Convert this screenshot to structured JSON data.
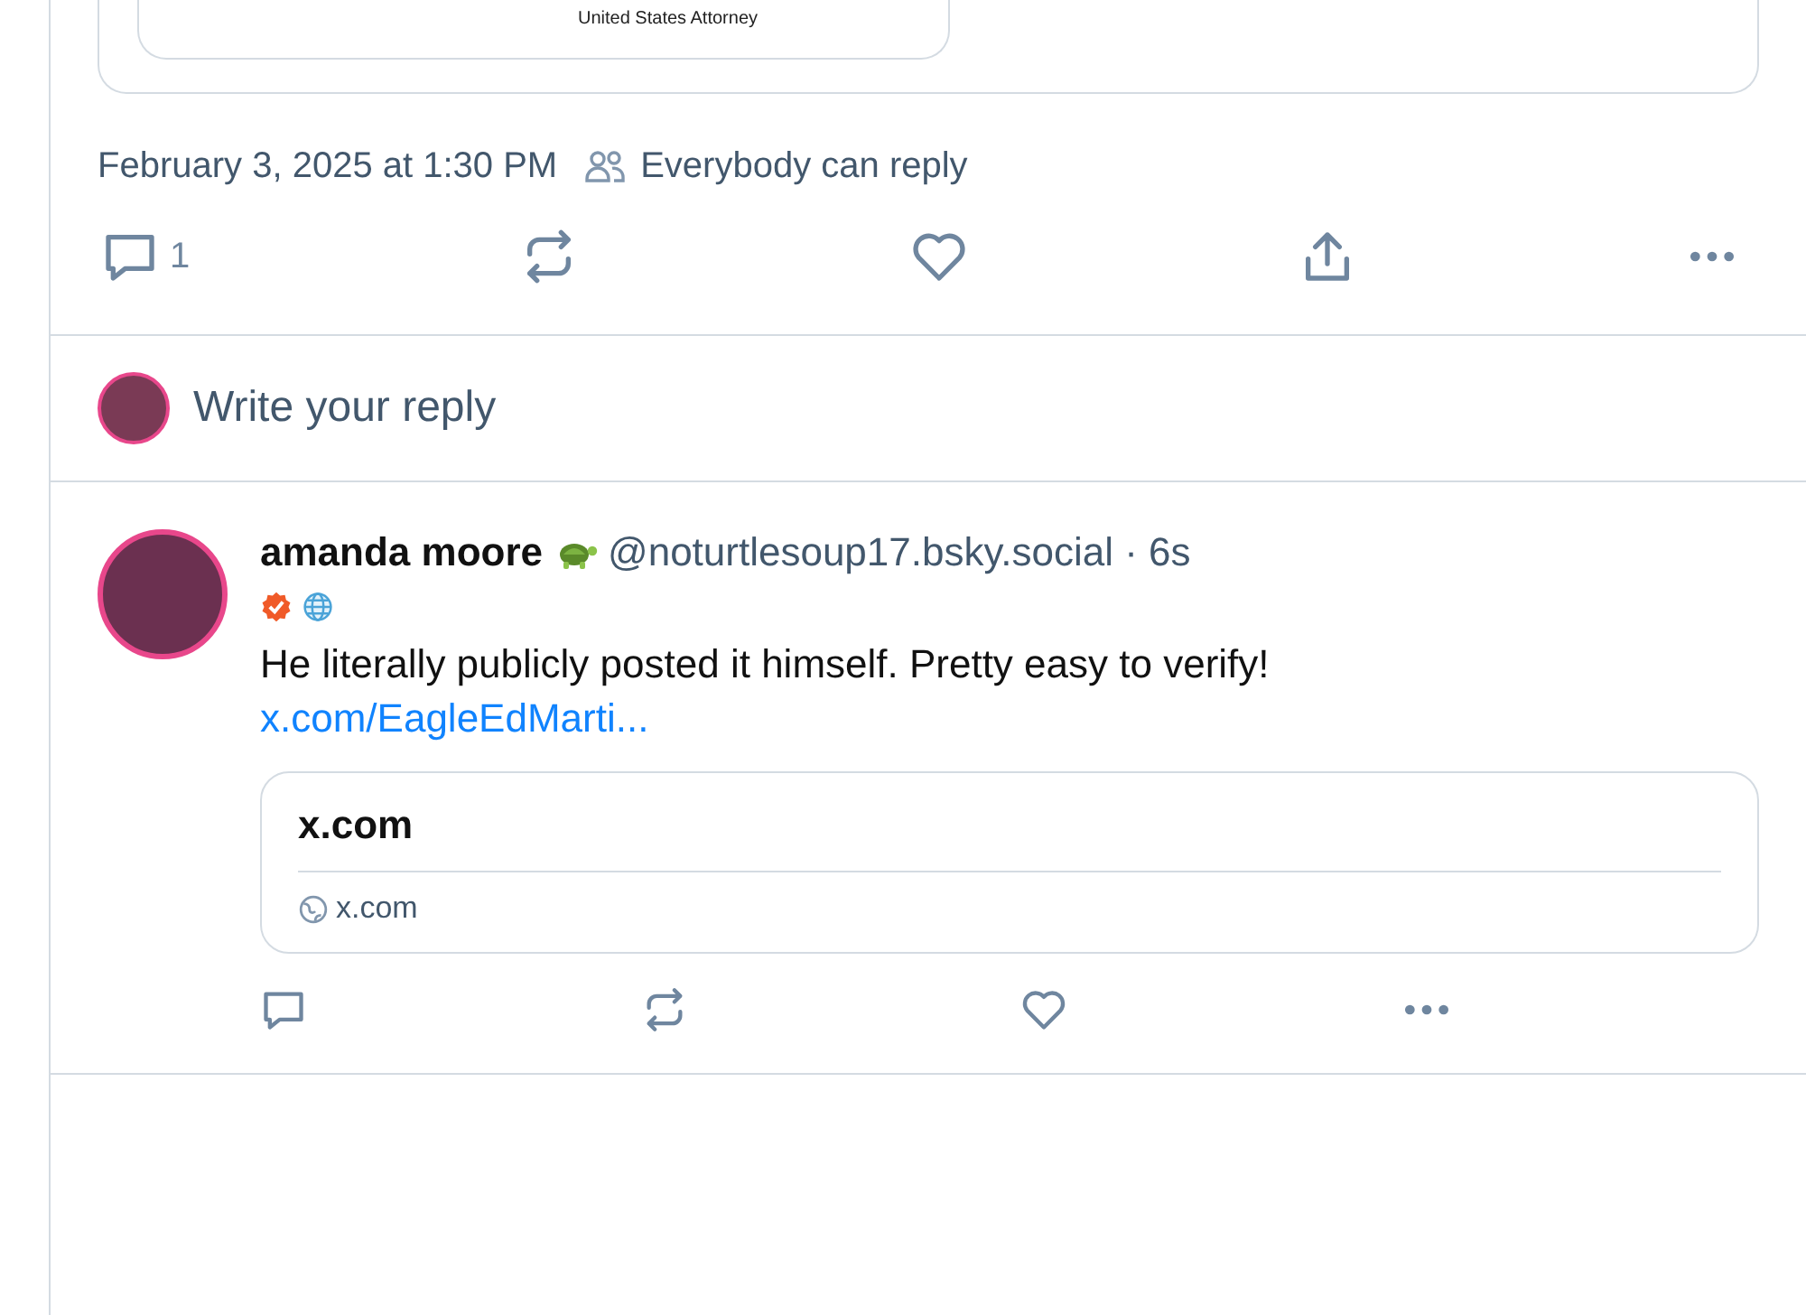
{
  "embed": {
    "signature_title": "United States Attorney"
  },
  "post": {
    "timestamp": "February 3, 2025 at 1:30 PM",
    "reply_setting": "Everybody can reply",
    "reply_count": "1"
  },
  "composer": {
    "placeholder": "Write your reply"
  },
  "reply": {
    "display_name": "amanda moore",
    "handle_and_age": "@noturtlesoup17.bsky.social · 6s",
    "text": "He literally publicly posted it himself. Pretty easy to verify!",
    "link": "x.com/EagleEdMarti...",
    "link_card": {
      "title": "x.com",
      "domain": "x.com"
    }
  }
}
